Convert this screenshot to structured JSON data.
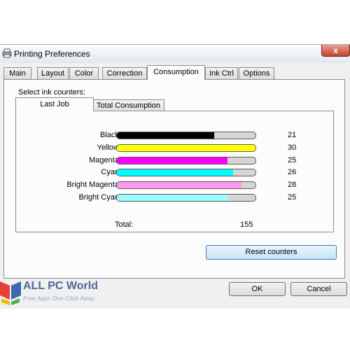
{
  "window": {
    "title": "Printing Preferences",
    "close_label": "x"
  },
  "tabs": [
    {
      "label": "Main",
      "active": false
    },
    {
      "label": "Layout",
      "active": false
    },
    {
      "label": "Color",
      "active": false
    },
    {
      "label": "Correction",
      "active": false
    },
    {
      "label": "Consumption",
      "active": true
    },
    {
      "label": "Ink Ctrl",
      "active": false
    },
    {
      "label": "Options",
      "active": false
    }
  ],
  "consumption": {
    "group_label": "Select ink counters:",
    "subtabs": [
      {
        "label": "Last Job",
        "active": true
      },
      {
        "label": "Total Consumption",
        "active": false
      }
    ],
    "inks": [
      {
        "name": "Black:",
        "value": "21",
        "level": 0.7,
        "color": "#000000"
      },
      {
        "name": "Yellow:",
        "value": "30",
        "level": 1.0,
        "color": "#ffff00"
      },
      {
        "name": "Magenta:",
        "value": "25",
        "level": 0.8,
        "color": "#ff00ff"
      },
      {
        "name": "Cyan:",
        "value": "26",
        "level": 0.84,
        "color": "#00ffff"
      },
      {
        "name": "Bright Magenta:",
        "value": "28",
        "level": 0.9,
        "color": "#ff99ee"
      },
      {
        "name": "Bright Cyan:",
        "value": "25",
        "level": 0.8,
        "color": "#99ffff"
      }
    ],
    "total_label": "Total:",
    "total_value": "155",
    "reset_label": "Reset counters"
  },
  "footer": {
    "ok_label": "OK",
    "cancel_label": "Cancel"
  },
  "watermark": {
    "title": "ALL PC World",
    "subtitle": "Free Apps One Click Away"
  }
}
